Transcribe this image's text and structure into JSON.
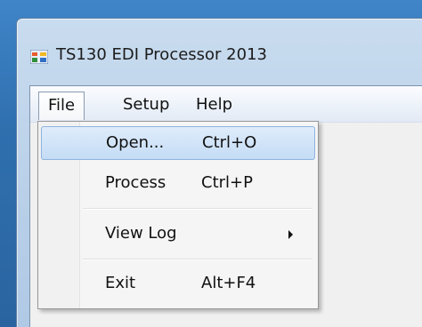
{
  "window": {
    "title": "TS130 EDI Processor 2013",
    "icon": "app-window-icon"
  },
  "menubar": {
    "items": [
      {
        "label": "File",
        "open": true
      },
      {
        "label": "Setup",
        "open": false
      },
      {
        "label": "Help",
        "open": false
      }
    ]
  },
  "file_menu": {
    "items": [
      {
        "label": "Open...",
        "shortcut": "Ctrl+O",
        "highlighted": true
      },
      {
        "label": "Process",
        "shortcut": "Ctrl+P",
        "highlighted": false
      },
      {
        "label": "View Log",
        "shortcut": "",
        "submenu": true
      },
      {
        "label": "Exit",
        "shortcut": "Alt+F4",
        "highlighted": false
      }
    ]
  },
  "colors": {
    "highlight": "#c4dcf5",
    "highlight_border": "#8fb3de",
    "titlebar": "#c9dcef"
  }
}
